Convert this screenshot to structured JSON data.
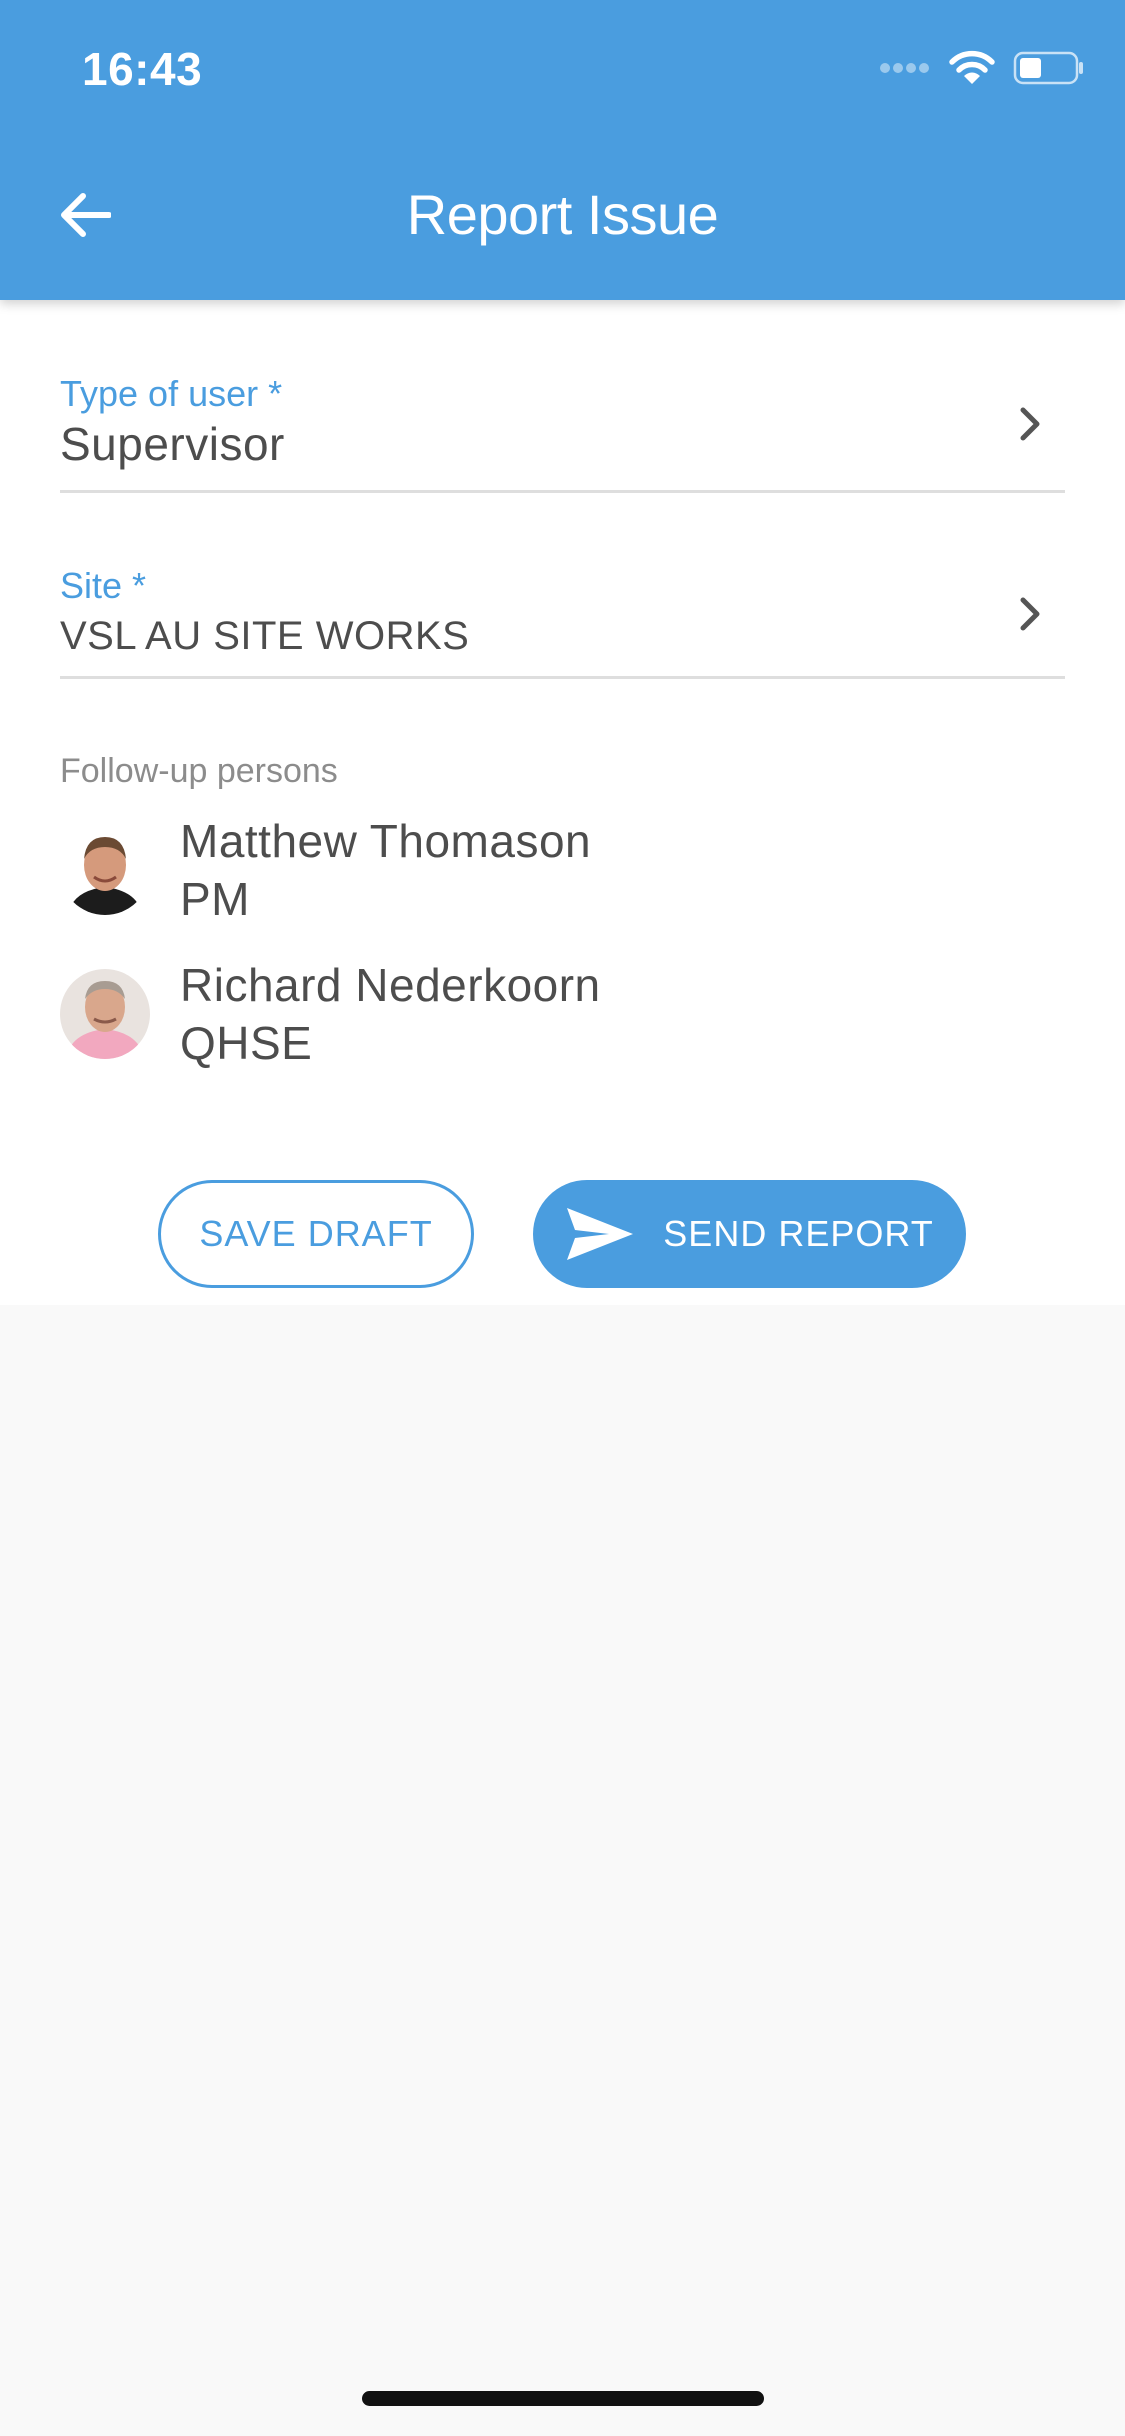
{
  "status_bar": {
    "time": "16:43"
  },
  "header": {
    "title": "Report Issue",
    "back_icon": "arrow-left-icon"
  },
  "form": {
    "user_type": {
      "label": "Type of user *",
      "value": "Supervisor"
    },
    "site": {
      "label": "Site *",
      "value": "VSL AU SITE WORKS"
    }
  },
  "followup": {
    "label": "Follow-up persons",
    "persons": [
      {
        "name": "Matthew Thomason",
        "role": "PM"
      },
      {
        "name": "Richard Nederkoorn",
        "role": "QHSE"
      }
    ]
  },
  "actions": {
    "save_draft_label": "SAVE DRAFT",
    "send_report_label": "SEND REPORT"
  },
  "colors": {
    "primary": "#4a9ddf",
    "text": "#4d4d4d",
    "muted": "#8c8c8c",
    "divider": "#dedede",
    "background": "#f9f9f9"
  }
}
